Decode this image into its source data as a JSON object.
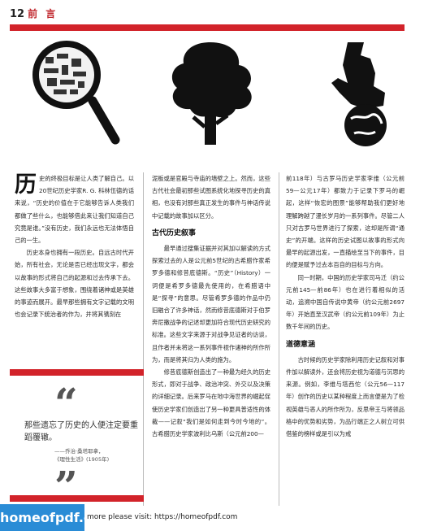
{
  "header": {
    "page_number": "12",
    "section": "前 言"
  },
  "col1": {
    "drop_cap": "历",
    "p1": "史的终极目标是让人类了解自己。以20世纪历史学家R. G. 科林伍德的话来说，“历史的价值在于它能够告诉人类我们都做了些什么，也能够借此来让我们知道自己究竟是谁。”没有历史，我们永远也无法体悟自己的一生。",
    "p2": "历史本身也拥有一段历史。自远古时代开始，所有社会，无论是否已经出现文字，都会以故事的形式将自己的起源和过去传承下去。这些故事大多富于想象，围绕着诸神或是英雄的事迹而展开。最早那些拥有文字记载的文明也会记录下统治者的作为，并将其镌刻在"
  },
  "quote": {
    "open_mark": "“",
    "text": "那些遗忘了历史的人便注定要重蹈覆辙。",
    "source_line1": "——乔治·桑塔耶拿，",
    "source_line2": "《理性生活》(1905年)",
    "close_mark": "”"
  },
  "col2": {
    "p1": "泥板或是官殿与寺庙的墙壁之上。然而，这些古代社会最初那些试图系统化地探寻历史的真相，也没有对那些真正发生的事件与神话传说中记载的故事加以区分。",
    "h1": "古代历史叙事",
    "p2": "最早通过搜集证据并对其加以解读的方式探索过去的人是公元前5世纪的古希腊作家希罗多德和修昔底德斯。“历史”（History）一词便是希罗多德最先使用的，在希腊语中是“探寻”的意思。尽管希罗多德的作品中仍旧融合了许多神话，然而修昔底德斯对于伯罗奔尼撒战争的记述却更加符合现代历史研究的标准。这些文字来源于对战争见证者的访谈，且作者并未将这一系列事件视作诸神的所作所为，而是将其归为人类的施为。",
    "p3": "修昔底德斯创造出了一种最为经久的历史形式，即对于战争、政治冲突、外交以及决策的详细记录。后来罗马在地中海世界的崛起促使历史学家们创造出了另一种更具普适性的体裁——记叙“我们是如何走到今时今地的”。古希腊历史学家波利比乌斯（公元前200—"
  },
  "col3": {
    "p1": "前118年）与古罗马历史学家李维（公元前59—公元17年）都致力于记录下罗马的崛起，这样“恢宏的图景”能够帮助我们更好地理解跨越了漫长岁月的一系列事件。尽管二人只对古罗马世界进行了探索，这却是所谓“通史”的开端。这样的历史试图以故事的形式向最早的起源出发，一直描绘至当下的事件，目的便是赋予过去本百自的目标与方向。",
    "p2": "同一时期，中国的历史学家司马迁（约公元前145—前86年）也在进行着相似的活动，追溯中国自传说中黄帝（约公元前2697年）开始直至汉武帝（约公元前109年）为止数千年间的历史。",
    "h1": "道德意涵",
    "p3": "古时候的历史学家除利用历史记叙和对事件加以解读外，还会将历史视为道德与沉思的来源。例如，李维与塔西佗（公元56—117年）创作的历史以某种程度上而言便是为了检视英雄与恶人的所作所为，反思帝王与将领品格中的优势和劣势，为品行端正之人树立可供借鉴的榜样或是引以为戒"
  },
  "footer": {
    "badge": "homeofpdf.com",
    "text": "more please visit: https://homeofpdf.com"
  },
  "colors": {
    "accent": "#d2232a",
    "badge": "#2a8cd6"
  },
  "icons": [
    "magnifying-glass-map-icon",
    "tree-icon",
    "hand-holding-globe-icon"
  ]
}
